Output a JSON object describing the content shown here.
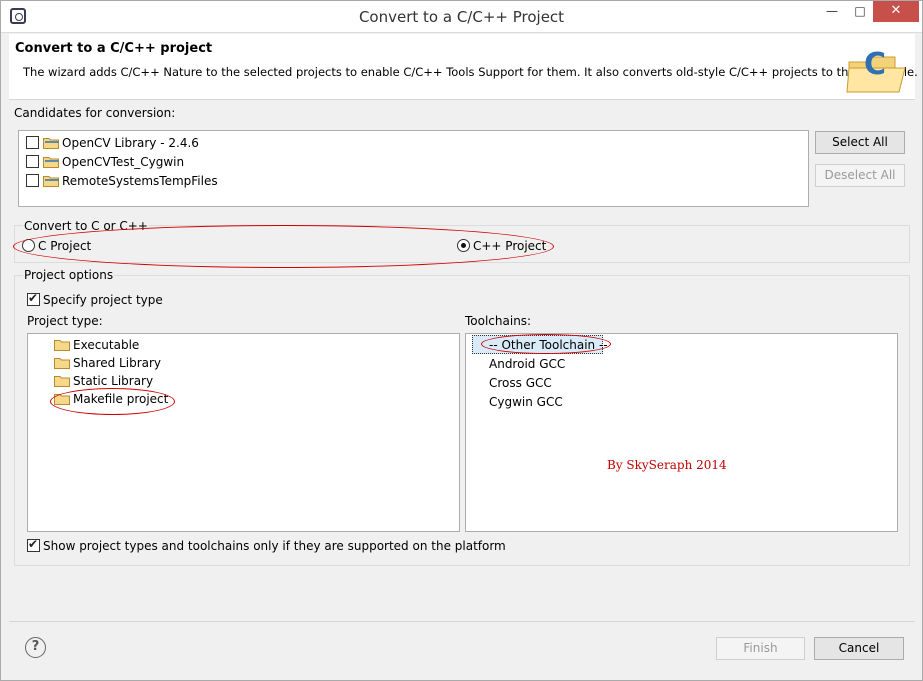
{
  "window": {
    "title": "Convert to a C/C++ Project",
    "minimize_glyph": "—",
    "maximize_glyph": "□",
    "close_glyph": "✕"
  },
  "header": {
    "title": "Convert to a C/C++ project",
    "description": "The wizard adds C/C++ Nature to the selected projects to enable C/C++ Tools Support for them. It also converts old-style C/C++ projects to the new style.",
    "icon_letter": "C"
  },
  "candidates": {
    "label": "Candidates for conversion:",
    "items": [
      {
        "label": "OpenCV Library - 2.4.6",
        "checked": false
      },
      {
        "label": "OpenCVTest_Cygwin",
        "checked": false
      },
      {
        "label": "RemoteSystemsTempFiles",
        "checked": false
      }
    ],
    "select_all": "Select All",
    "deselect_all": "Deselect All"
  },
  "convert": {
    "label": "Convert to C or C++",
    "c_project": "C Project",
    "cpp_project": "C++ Project",
    "selected": "C++ Project"
  },
  "options": {
    "label": "Project options",
    "specify_type": "Specify project type",
    "specify_type_checked": true,
    "project_type_label": "Project type:",
    "project_types": [
      "Executable",
      "Shared Library",
      "Static Library",
      "Makefile project"
    ],
    "toolchains_label": "Toolchains:",
    "toolchains": [
      "-- Other Toolchain --",
      "Android GCC",
      "Cross GCC",
      "Cygwin GCC"
    ],
    "selected_toolchain": "-- Other Toolchain --",
    "show_supported": "Show project types and toolchains only if they are supported on the platform",
    "show_supported_checked": true
  },
  "watermark": "By SkySeraph 2014",
  "footer": {
    "help_glyph": "?",
    "finish": "Finish",
    "cancel": "Cancel"
  },
  "colors": {
    "annotation": "#d00000",
    "close_button": "#c7504b",
    "selection": "#d9ebf9"
  }
}
